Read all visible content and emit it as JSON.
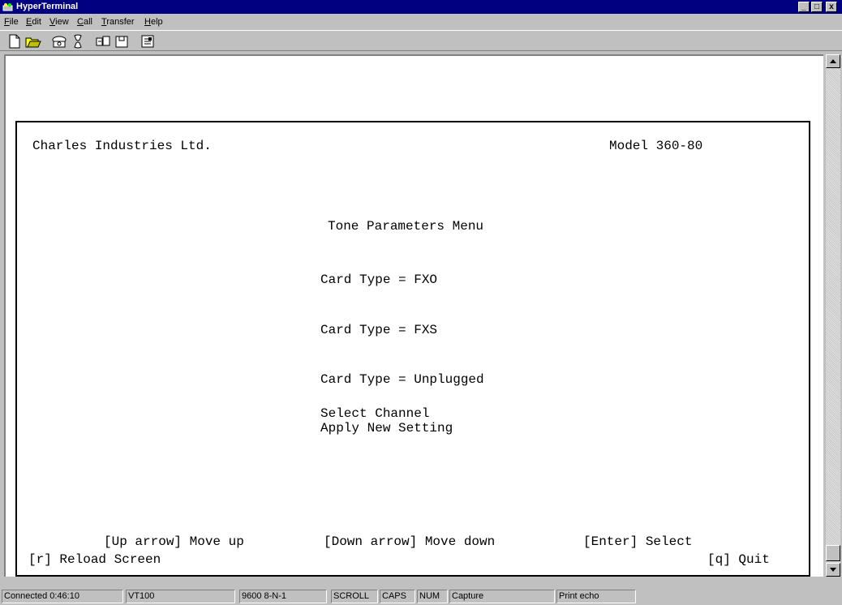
{
  "window": {
    "title": "HyperTerminal",
    "controls": [
      "_",
      "□",
      "x"
    ]
  },
  "menu": {
    "items": [
      {
        "accel": "F",
        "rest": "ile"
      },
      {
        "accel": "E",
        "rest": "dit"
      },
      {
        "accel": "V",
        "rest": "iew"
      },
      {
        "accel": "C",
        "rest": "all"
      },
      {
        "accel": "T",
        "rest": "ransfer"
      },
      {
        "accel": "H",
        "rest": "elp"
      }
    ]
  },
  "toolbar": {
    "buttons": [
      "new-icon",
      "open-icon",
      "connect-icon",
      "disconnect-icon",
      "send-icon",
      "receive-icon",
      "properties-icon"
    ]
  },
  "terminal": {
    "company": "Charles Industries Ltd.",
    "model": "Model 360-80",
    "menu_title": "Tone Parameters Menu",
    "option_fxo": "Card Type = FXO",
    "option_fxs": "Card Type = FXS",
    "option_unplugged": "Card Type = Unplugged",
    "option_select_channel": "Select Channel",
    "option_apply": "Apply New Setting",
    "help_up": "[Up arrow] Move up",
    "help_down": "[Down arrow] Move down",
    "help_enter": "[Enter] Select",
    "help_reload": "[r] Reload Screen",
    "help_quit": "[q] Quit"
  },
  "status": {
    "connected": "Connected 0:46:10",
    "emulation": "VT100",
    "settings": "9600 8-N-1",
    "scroll": "SCROLL",
    "caps": "CAPS",
    "num": "NUM",
    "capture": "Capture",
    "print_echo": "Print echo"
  }
}
